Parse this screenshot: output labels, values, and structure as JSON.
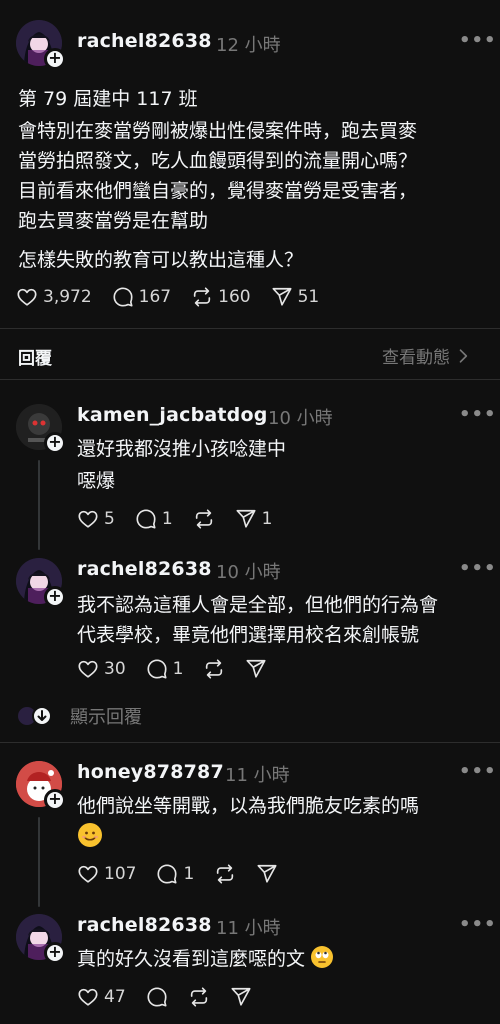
{
  "main_post": {
    "username": "rachel82638",
    "time": "12 小時",
    "lines": [
      "第 79 屆建中 117 班",
      "會特別在麥當勞剛被爆出性侵案件時，跑去買麥",
      "當勞拍照發文，吃人血饅頭得到的流量開心嗎？",
      "目前看來他們蠻自豪的，覺得麥當勞是受害者，",
      "跑去買麥當勞是在幫助",
      "怎樣失敗的教育可以教出這種人？"
    ],
    "likes": "3,972",
    "comments": "167",
    "reposts": "160",
    "shares": "51"
  },
  "replies_bar": {
    "label": "回覆",
    "activity": "查看動態"
  },
  "replies": [
    {
      "username": "kamen_jacbatdog",
      "time": "10 小時",
      "lines": [
        "還好我都沒推小孩唸建中",
        "噁爆"
      ],
      "likes": "5",
      "comments": "1",
      "reposts": "",
      "shares": "1"
    },
    {
      "username": "rachel82638",
      "time": "10 小時",
      "lines": [
        "我不認為這種人會是全部，但他們的行為會",
        "代表學校，畢竟他們選擇用校名來創帳號"
      ],
      "likes": "30",
      "comments": "1",
      "reposts": "",
      "shares": ""
    },
    {
      "username": "honey878787",
      "time": "11 小時",
      "lines": [
        "他們說坐等開戰，以為我們脆友吃素的嗎",
        ""
      ],
      "likes": "107",
      "comments": "1",
      "reposts": "",
      "shares": ""
    },
    {
      "username": "rachel82638",
      "time": "11 小時",
      "lines": [
        "真的好久沒看到這麼噁的文"
      ],
      "likes": "47",
      "comments": "",
      "reposts": "",
      "shares": ""
    }
  ],
  "show_replies": {
    "label": "顯示回覆"
  },
  "icons": {
    "like": "heart-icon",
    "comment": "comment-icon",
    "repost": "repost-icon",
    "share": "send-icon",
    "more": "more-icon",
    "follow": "plus-icon"
  },
  "colors": {
    "background": "#101010",
    "text": "#f3f5f7",
    "muted": "#777777"
  }
}
